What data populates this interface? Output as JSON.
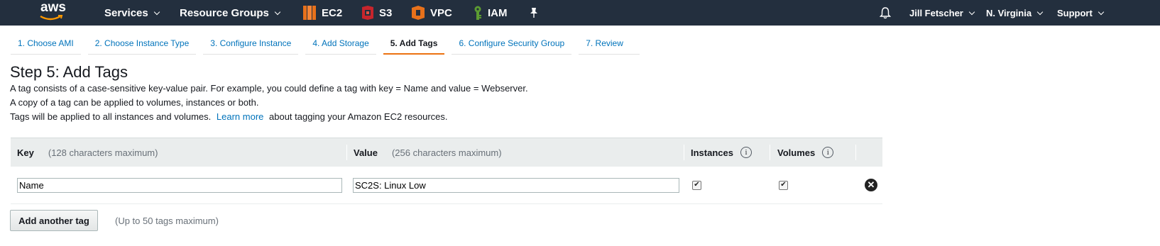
{
  "topnav": {
    "logo": "aws",
    "services": "Services",
    "resource_groups": "Resource Groups",
    "shortcuts": [
      {
        "label": "EC2",
        "icon": "ec2-icon",
        "color": "#e7711b"
      },
      {
        "label": "S3",
        "icon": "s3-icon",
        "color": "#c7252c"
      },
      {
        "label": "VPC",
        "icon": "vpc-icon",
        "color": "#e7711b"
      },
      {
        "label": "IAM",
        "icon": "iam-icon",
        "color": "#5c9c32"
      }
    ],
    "user": "Jill Fetscher",
    "region": "N. Virginia",
    "support": "Support",
    "bg_color": "#232f3e",
    "accent": "#ec7211"
  },
  "steps": [
    {
      "label": "1. Choose AMI"
    },
    {
      "label": "2. Choose Instance Type"
    },
    {
      "label": "3. Configure Instance"
    },
    {
      "label": "4. Add Storage"
    },
    {
      "label": "5. Add Tags"
    },
    {
      "label": "6. Configure Security Group"
    },
    {
      "label": "7. Review"
    }
  ],
  "page": {
    "title": "Step 5: Add Tags",
    "line1": "A tag consists of a case-sensitive key-value pair. For example, you could define a tag with key = Name and value = Webserver.",
    "line2": "A copy of a tag can be applied to volumes, instances or both.",
    "line3_pre": "Tags will be applied to all instances and volumes.",
    "learn_more": "Learn more",
    "line3_post": "about tagging your Amazon EC2 resources."
  },
  "table": {
    "key_header": "Key",
    "key_hint": "(128 characters maximum)",
    "value_header": "Value",
    "value_hint": "(256 characters maximum)",
    "instances_header": "Instances",
    "volumes_header": "Volumes",
    "info_glyph": "i",
    "rows": [
      {
        "key": "Name",
        "value": "SC2S: Linux Low",
        "instances": true,
        "volumes": true
      }
    ]
  },
  "add_button": "Add another tag",
  "add_hint": "(Up to 50 tags maximum)"
}
